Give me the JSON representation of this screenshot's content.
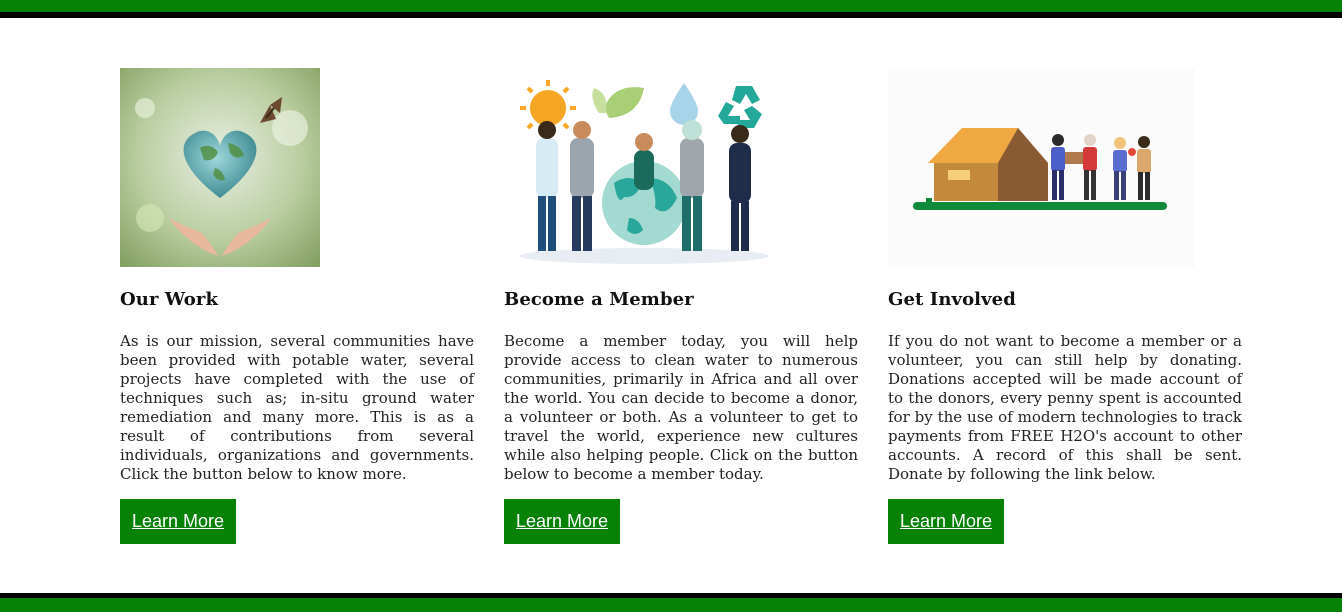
{
  "colors": {
    "accent": "#068206",
    "rule": "#000000"
  },
  "cards": [
    {
      "title": "Our Work",
      "image": "earth-heart-hands-butterfly",
      "text": "As is our mission, several communities have been provided with potable water, several projects have completed with the use of techniques such as; in-situ ground water remediation and many more. This is as a result of contributions from several individuals, organizations and governments. Click the button below to know more.",
      "button": "Learn More"
    },
    {
      "title": "Become a Member",
      "image": "people-holding-globe-sun-leaf-water-recycle",
      "text": "Become a member today, you will help provide access to clean water to numerous communities, primarily in Africa and all over the world. You can decide to become a donor, a volunteer or both. As a volunteer to get to travel the world, experience new cultures while also helping people. Click on the button below to become a member today.",
      "button": "Learn More"
    },
    {
      "title": "Get Involved",
      "image": "volunteers-carrying-boxes-to-tent",
      "text": "If you do not want to become a member or a volunteer, you can still help by donating. Donations accepted will be made account of to the donors, every penny spent is accounted for by the use of modern technologies to track payments from FREE H2O's account to other accounts. A record of this shall be sent. Donate by following the link below.",
      "button": "Learn More"
    }
  ]
}
